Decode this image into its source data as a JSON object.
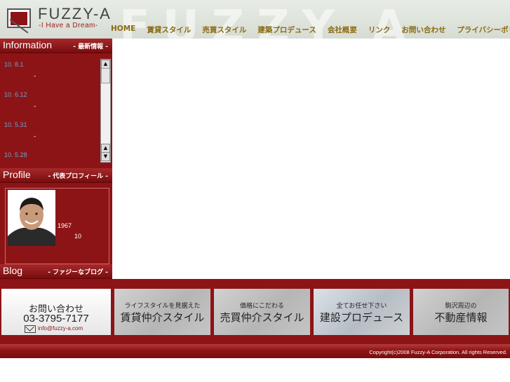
{
  "header": {
    "logo_text": "FUZZY-A",
    "tagline": "-I Have a Dream-",
    "nav": [
      "HOME",
      "賃貸スタイル",
      "売買スタイル",
      "建築プロデュース",
      "会社概要",
      "リンク",
      "お問い合わせ",
      "プライバシーポリシー"
    ]
  },
  "sidebar": {
    "information": {
      "title": "Information",
      "subtitle": "- 最新情報 -"
    },
    "news": [
      {
        "date": "10. 8.1",
        "text": "-"
      },
      {
        "date": "10. 6.12",
        "text": "-"
      },
      {
        "date": "10. 5.31",
        "text": "-"
      },
      {
        "date": "10. 5.28",
        "text": ""
      }
    ],
    "profile": {
      "title": "Profile",
      "subtitle": "- 代表プロフィール -",
      "year": "1967",
      "number": "10"
    },
    "blog": {
      "title": "Blog",
      "subtitle": "- ファジーなブログ -"
    }
  },
  "banners": {
    "contact": {
      "title": "お問い合わせ",
      "phone": "03-3795-7177",
      "email": "info@fuzzy-a.com"
    },
    "rental": {
      "small": "ライフスタイルを見据えた",
      "big": "賃貸仲介スタイル"
    },
    "sales": {
      "small": "価格にこだわる",
      "big": "売買仲介スタイル"
    },
    "construction": {
      "small": "全てお任せ下さい",
      "big": "建設プロデュース"
    },
    "local": {
      "small": "駒沢周辺の",
      "big": "不動産情報"
    }
  },
  "footer": {
    "copyright": "Copyright(c)2008 Fuzzy-A Corporation. All rights Reserved."
  },
  "colors": {
    "brand_red": "#8d1416",
    "nav_gold": "#8a6a10",
    "date_blue": "#6ea0c8"
  }
}
